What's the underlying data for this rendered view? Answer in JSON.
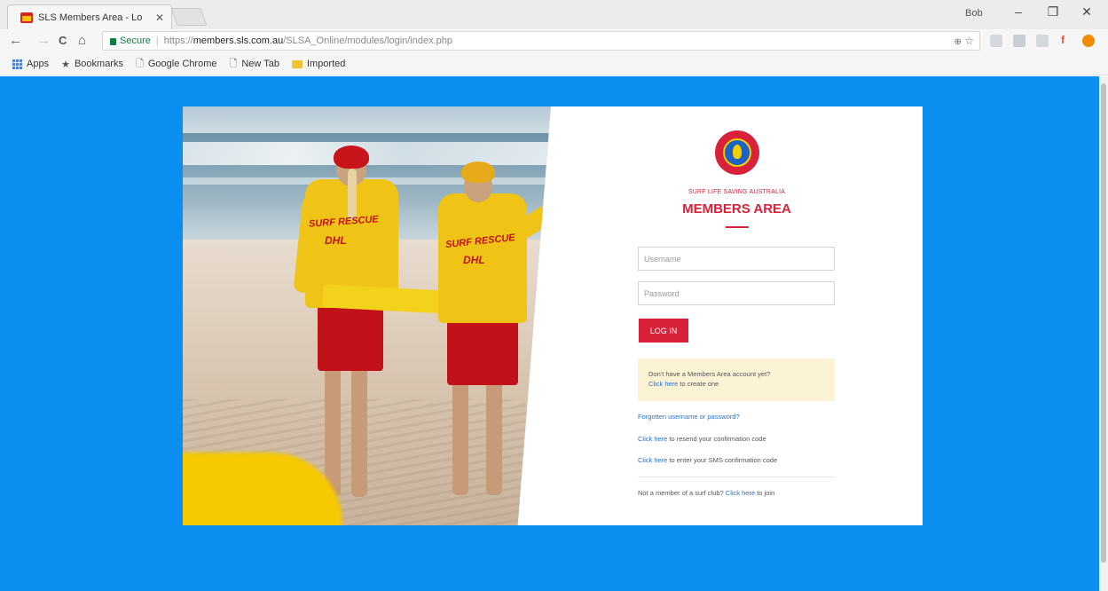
{
  "browser": {
    "tab_title": "SLS Members Area - Lo",
    "tab_close": "✕",
    "user_chip": "Bob",
    "window_controls": [
      "–",
      "❐",
      "✕"
    ],
    "secure_label": "Secure",
    "separator": "|",
    "url_proto": "https://",
    "url_host": "members.sls.com.au",
    "url_path": "/SLSA_Online/modules/login/index.php",
    "bookmarks": [
      "Apps",
      "Bookmarks",
      "Google Chrome",
      "New Tab",
      "Imported"
    ],
    "icons": {
      "back": "←",
      "forward": "→",
      "reload": "C",
      "home": "⌂",
      "zoom": "🔍",
      "star": "☆"
    },
    "colors": {
      "page_bg": "#0a8ef0",
      "brand_red": "#d9223a",
      "secure_green": "#0b8043"
    }
  },
  "hero": {
    "left_shirt_top": "SURF RESCUE",
    "left_shirt_bottom": "DHL",
    "right_shirt_top": "SURF RESCUE",
    "right_shirt_bottom": "DHL"
  },
  "login": {
    "brand_sub": "SURF LIFE SAVING AUSTRALIA",
    "brand_title": "MEMBERS AREA",
    "username_placeholder": "Username",
    "password_placeholder": "Password",
    "login_button": "LOG IN",
    "notice_text": "Don't have a Members Area account yet?",
    "notice_link": "Click here",
    "notice_tail": " to create one",
    "forgot_link": "Forgotten username or password?",
    "resend_link": "Click here",
    "resend_tail": " to resend your confirmation code",
    "sms_link": "Click here",
    "sms_tail": " to enter your SMS confirmation code",
    "join_lead": "Not a member of a surf club? ",
    "join_link": "Click here",
    "join_tail": " to join"
  }
}
